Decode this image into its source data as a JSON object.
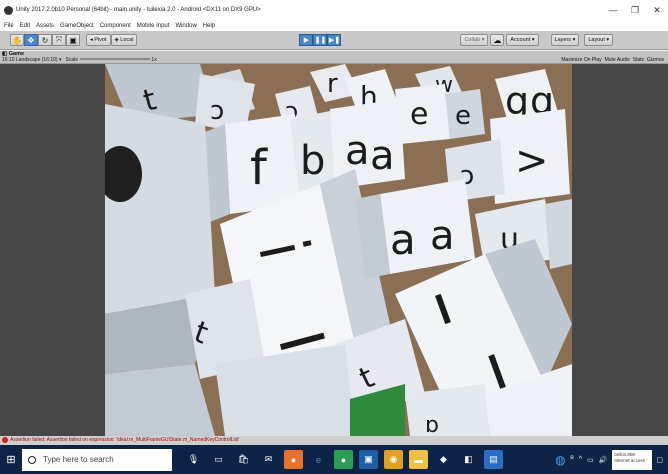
{
  "window": {
    "title": "Unity 2017.2.0b10 Personal (64bit) - main.unity - tuilexia 2.0 - Android <DX11 on DX9 GPU>",
    "controls": [
      "—",
      "❐",
      "✕"
    ]
  },
  "menu": [
    "File",
    "Edit",
    "Assets",
    "GameObject",
    "Component",
    "Mobile Input",
    "Window",
    "Help"
  ],
  "toolbar": {
    "pivot": "Pivot",
    "local": "Local",
    "collab": "Collab",
    "account": "Account",
    "layers": "Layers",
    "layout": "Layout"
  },
  "game": {
    "tab": "Game",
    "aspect": "16:10 Landscape (16:10)",
    "scale_label": "Scale",
    "scale_value": "1x",
    "options": [
      "Maximize On Play",
      "Mute Audio",
      "Stats",
      "Gizmos"
    ]
  },
  "scene": {
    "background": "#8a6f55",
    "cube_face": "#eef1f5",
    "cube_shade": "#c9d0d8",
    "glyph_color": "#1c1c1c"
  },
  "console": {
    "message": "Assertion failed: Assertion failed on expression: 'ideal.m_MultiFrameGUIState.m_NamedKeyControlList'"
  },
  "taskbar": {
    "search_placeholder": "Type here to search",
    "network_name": "belkin.808",
    "network_status": "Internet access"
  }
}
